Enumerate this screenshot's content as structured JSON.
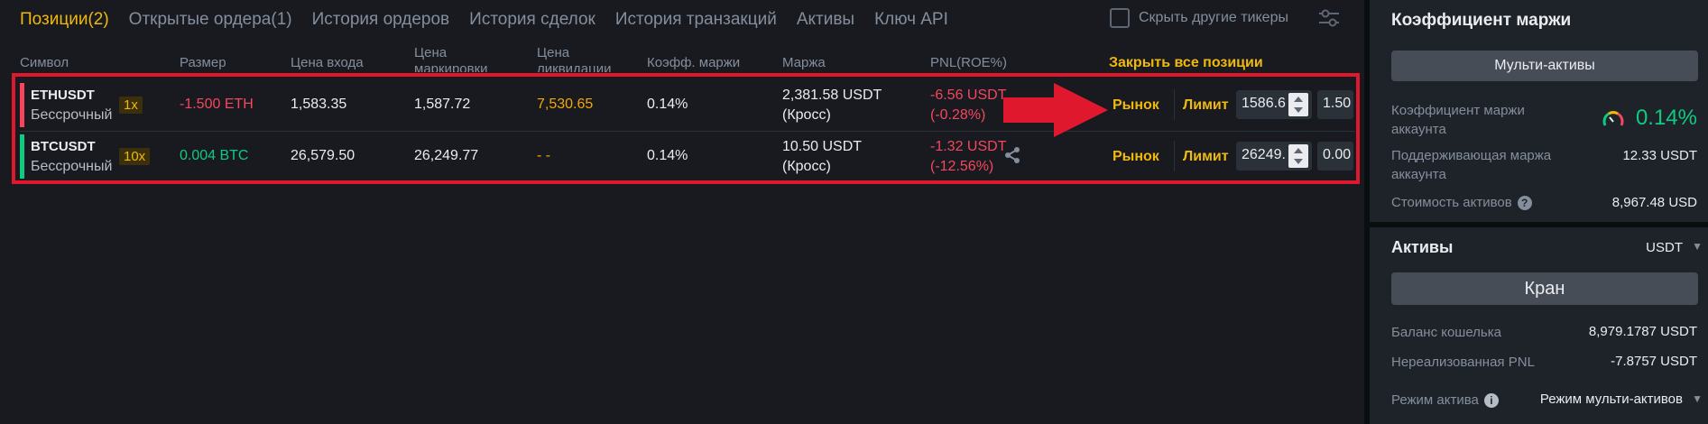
{
  "tabs": [
    {
      "label": "Позиции(2)",
      "active": true
    },
    {
      "label": "Открытые ордера(1)",
      "active": false
    },
    {
      "label": "История ордеров",
      "active": false
    },
    {
      "label": "История сделок",
      "active": false
    },
    {
      "label": "История транзакций",
      "active": false
    },
    {
      "label": "Активы",
      "active": false
    },
    {
      "label": "Ключ API",
      "active": false
    }
  ],
  "hide_tickers_label": "Скрыть другие тикеры",
  "columns": {
    "symbol": "Символ",
    "size": "Размер",
    "entry_price": "Цена входа",
    "mark_price": "Цена маркировки",
    "liq_price": "Цена ликвидации",
    "margin_ratio": "Коэфф. маржи",
    "margin": "Маржа",
    "pnl": "PNL(ROE%)"
  },
  "close_all_label": "Закрыть все позиции",
  "positions": [
    {
      "symbol": "ETHUSDT",
      "type": "Бессрочный",
      "leverage": "1x",
      "size": "-1.500 ETH",
      "entry_price": "1,583.35",
      "mark_price": "1,587.72",
      "liq_price": "7,530.65",
      "margin_ratio": "0.14%",
      "margin_value": "2,381.58 USDT",
      "margin_mode": "(Кросс)",
      "pnl": "-6.56 USDT",
      "roe": "(-0.28%)",
      "market_label": "Рынок",
      "limit_label": "Лимит",
      "limit_price": "1586.6",
      "qty": "1.50"
    },
    {
      "symbol": "BTCUSDT",
      "type": "Бессрочный",
      "leverage": "10x",
      "size": "0.004 BTC",
      "entry_price": "26,579.50",
      "mark_price": "26,249.77",
      "liq_price": "- -",
      "margin_ratio": "0.14%",
      "margin_value": "10.50 USDT",
      "margin_mode": "(Кросс)",
      "pnl": "-1.32 USDT",
      "roe": "(-12.56%)",
      "market_label": "Рынок",
      "limit_label": "Лимит",
      "limit_price": "26249.",
      "qty": "0.00"
    }
  ],
  "side_panel": {
    "title": "Коэффициент маржи",
    "multi_assets_button": "Мульти-активы",
    "account_margin_ratio_label": "Коэффициент маржи аккаунта",
    "account_margin_ratio": "0.14%",
    "maintenance_margin_label": "Поддерживающая маржа аккаунта",
    "maintenance_margin": "12.33 USDT",
    "asset_value_label": "Стоимость активов",
    "asset_value": "8,967.48 USD",
    "assets_title": "Активы",
    "assets_currency": "USDT",
    "faucet_button": "Кран",
    "wallet_balance_label": "Баланс кошелька",
    "wallet_balance": "8,979.1787 USDT",
    "unrealized_pnl_label": "Нереализованная PNL",
    "unrealized_pnl": "-7.8757 USDT",
    "asset_mode_label": "Режим актива",
    "asset_mode_value": "Режим мульти-активов"
  },
  "colors": {
    "accent": "#f0b90b",
    "sell": "#f6465d",
    "buy": "#0ecb81",
    "liq": "#f7a600",
    "highlight_frame": "#e0182d"
  }
}
